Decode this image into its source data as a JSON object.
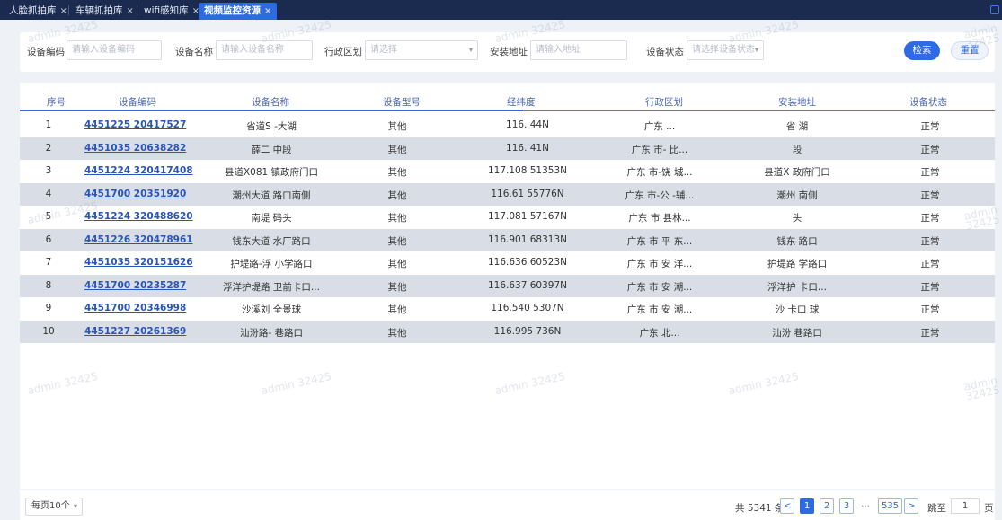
{
  "tabs": [
    {
      "label": "人脸抓拍库",
      "close": "×",
      "active": false
    },
    {
      "label": "车辆抓拍库",
      "close": "×",
      "active": false
    },
    {
      "label": "wifi感知库",
      "close": "×",
      "active": false
    },
    {
      "label": "视频监控资源",
      "close": "×",
      "active": true
    }
  ],
  "filters": {
    "device_code_label": "设备编码 :",
    "device_code_placeholder": "请输入设备编码",
    "device_name_label": "设备名称 :",
    "device_name_placeholder": "请输入设备名称",
    "region_label": "行政区划 :",
    "region_placeholder": "请选择",
    "address_label": "安装地址 :",
    "address_placeholder": "请输入地址",
    "status_label": "设备状态 :",
    "status_placeholder": "请选择设备状态",
    "search_button": "检索",
    "reset_button": "重置"
  },
  "table": {
    "columns": [
      "序号",
      "设备编码",
      "设备名称",
      "设备型号",
      "经纬度",
      "行政区划",
      "安装地址",
      "设备状态"
    ],
    "rows": [
      {
        "no": "1",
        "code": "4451225 20417527",
        "name": "省道S -大湖",
        "model": "其他",
        "coords": "116. 44N",
        "region": "广东 ...",
        "address": "省 湖",
        "status": "正常"
      },
      {
        "no": "2",
        "code": "4451035 20638282",
        "name": "薛二 中段",
        "model": "其他",
        "coords": "116. 41N",
        "region": "广东 市- 比...",
        "address": "段",
        "status": "正常"
      },
      {
        "no": "3",
        "code": "4451224 320417408",
        "name": "县道X081 镇政府门口",
        "model": "其他",
        "coords": "117.108 51353N",
        "region": "广东 市-饶 城...",
        "address": "县道X 政府门口",
        "status": "正常"
      },
      {
        "no": "4",
        "code": "4451700 20351920",
        "name": "潮州大道 路口南侧",
        "model": "其他",
        "coords": "116.61 55776N",
        "region": "广东 市-公 -辅...",
        "address": "潮州 南侧",
        "status": "正常"
      },
      {
        "no": "5",
        "code": "4451224 320488620",
        "name": "南堤 码头",
        "model": "其他",
        "coords": "117.081 57167N",
        "region": "广东 市 县林...",
        "address": "头",
        "status": "正常"
      },
      {
        "no": "6",
        "code": "4451226 320478961",
        "name": "钱东大道 水厂路口",
        "model": "其他",
        "coords": "116.901 68313N",
        "region": "广东 市 平 东...",
        "address": "钱东 路口",
        "status": "正常"
      },
      {
        "no": "7",
        "code": "4451035 320151626",
        "name": "护堤路-浮 小学路口",
        "model": "其他",
        "coords": "116.636 60523N",
        "region": "广东 市 安 洋...",
        "address": "护堤路 学路口",
        "status": "正常"
      },
      {
        "no": "8",
        "code": "4451700 20235287",
        "name": "浮洋护堤路 卫前卡口...",
        "model": "其他",
        "coords": "116.637 60397N",
        "region": "广东 市 安 潮...",
        "address": "浮洋护 卡口...",
        "status": "正常"
      },
      {
        "no": "9",
        "code": "4451700 20346998",
        "name": "沙溪刘 全景球",
        "model": "其他",
        "coords": "116.540 5307N",
        "region": "广东 市 安 潮...",
        "address": "沙 卡口 球",
        "status": "正常"
      },
      {
        "no": "10",
        "code": "4451227 20261369",
        "name": "汕汾路- 巷路口",
        "model": "其他",
        "coords": "116.995 736N",
        "region": "广东 北...",
        "address": "汕汾 巷路口",
        "status": "正常"
      }
    ]
  },
  "pagination": {
    "page_size": "每页10个",
    "total": "共 5341 条",
    "prev": "<",
    "pages": [
      "1",
      "2",
      "3"
    ],
    "ellipsis": "···",
    "last": "535",
    "next": ">",
    "jump_label": "跳至",
    "jump_value": "1",
    "page_suffix": "页"
  },
  "watermark": "admin 32425"
}
